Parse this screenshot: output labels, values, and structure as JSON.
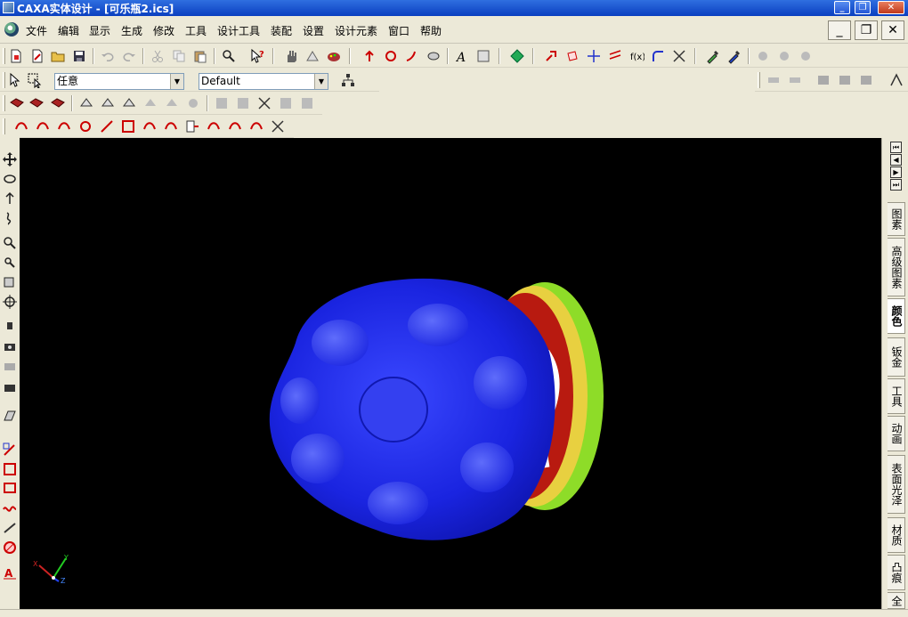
{
  "window": {
    "title": "CAXA实体设计 - [可乐瓶2.ics]",
    "minimize_glyph": "_",
    "restore_glyph": "❐",
    "close_glyph": "✕"
  },
  "menu": {
    "items": [
      "文件",
      "编辑",
      "显示",
      "生成",
      "修改",
      "工具",
      "设计工具",
      "装配",
      "设置",
      "设计元素",
      "窗口",
      "帮助"
    ],
    "mdi_minimize": "_",
    "mdi_restore": "❐",
    "mdi_close": "✕"
  },
  "toolbar": {
    "selection_filter": {
      "value": "任意"
    },
    "style_filter": {
      "value": "Default"
    }
  },
  "side_tabs": {
    "nav": [
      "⏮",
      "◀",
      "▶",
      "⏭"
    ],
    "items": [
      {
        "label": "图素",
        "active": false
      },
      {
        "label": "高级图素",
        "active": false
      },
      {
        "label": "颜色",
        "active": true
      },
      {
        "label": "钣金",
        "active": false
      },
      {
        "label": "工具",
        "active": false
      },
      {
        "label": "动画",
        "active": false
      },
      {
        "label": "表面光泽",
        "active": false
      },
      {
        "label": "材质",
        "active": false
      },
      {
        "label": "凸痕",
        "active": false
      },
      {
        "label": "全",
        "active": false
      }
    ]
  },
  "viewport": {
    "background": "#000000",
    "axis_triad": {
      "x_label": "X",
      "y_label": "Y",
      "z_label": "Z"
    },
    "model": {
      "cap_color": "#1a24e0",
      "label_colors": [
        "#b81a10",
        "#e8d040",
        "#8edc28"
      ]
    }
  }
}
